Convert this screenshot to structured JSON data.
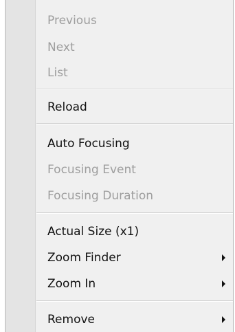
{
  "menu": {
    "items": [
      {
        "label": "Previous",
        "enabled": false
      },
      {
        "label": "Next",
        "enabled": false
      },
      {
        "label": "List",
        "enabled": false
      },
      {
        "label": "Reload",
        "enabled": true
      },
      {
        "label": "Auto Focusing",
        "enabled": true
      },
      {
        "label": "Focusing Event",
        "enabled": false
      },
      {
        "label": "Focusing Duration",
        "enabled": false
      },
      {
        "label": "Actual Size (x1)",
        "enabled": true
      },
      {
        "label": "Zoom Finder",
        "enabled": true,
        "submenu": true
      },
      {
        "label": "Zoom In",
        "enabled": true,
        "submenu": true
      },
      {
        "label": "Remove",
        "enabled": true,
        "submenu": true
      }
    ]
  },
  "colors": {
    "background": "#f0f0f0",
    "gutter": "#e4e4e4",
    "enabled_text": "#111111",
    "disabled_text": "#9e9e9e",
    "separator": "#cfcfcf"
  },
  "icons": {
    "submenu_arrow": "submenu-arrow-icon"
  }
}
